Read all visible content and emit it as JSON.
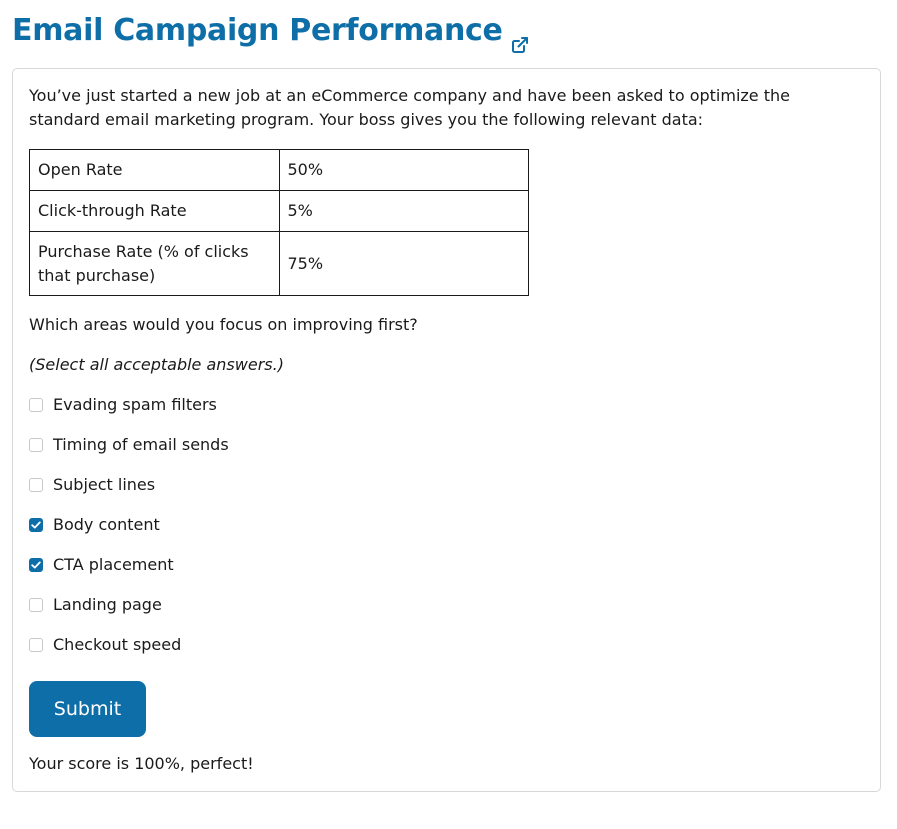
{
  "title": "Email Campaign Performance",
  "title_icon": "external-link-icon",
  "colors": {
    "accent": "#0e6ea8",
    "text": "#1a1a1a",
    "card_border": "#d8d8d8",
    "checkbox_border": "#c9c9c9"
  },
  "intro": "You’ve just started a new job at an eCommerce company and have been asked to optimize the standard email marketing program. Your boss gives you the following relevant data:",
  "table": {
    "rows": [
      {
        "metric": "Open Rate",
        "value": "50%"
      },
      {
        "metric": "Click-through Rate",
        "value": "5%"
      },
      {
        "metric": "Purchase Rate (% of clicks that purchase)",
        "value": "75%"
      }
    ]
  },
  "question": "Which areas would you focus on improving first?",
  "hint": "(Select all acceptable answers.)",
  "options": [
    {
      "label": "Evading spam filters",
      "checked": false
    },
    {
      "label": "Timing of email sends",
      "checked": false
    },
    {
      "label": "Subject lines",
      "checked": false
    },
    {
      "label": "Body content",
      "checked": true
    },
    {
      "label": "CTA placement",
      "checked": true
    },
    {
      "label": "Landing page",
      "checked": false
    },
    {
      "label": "Checkout speed",
      "checked": false
    }
  ],
  "submit_label": "Submit",
  "score_text": "Your score is 100%, perfect!"
}
